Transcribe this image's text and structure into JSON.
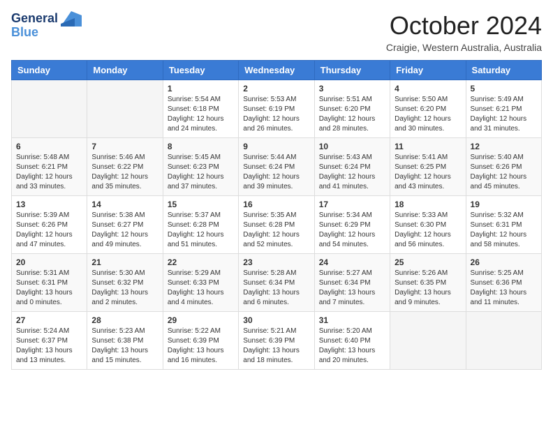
{
  "header": {
    "logo_line1": "General",
    "logo_line2": "Blue",
    "month_title": "October 2024",
    "location": "Craigie, Western Australia, Australia"
  },
  "weekdays": [
    "Sunday",
    "Monday",
    "Tuesday",
    "Wednesday",
    "Thursday",
    "Friday",
    "Saturday"
  ],
  "weeks": [
    [
      {
        "day": "",
        "info": ""
      },
      {
        "day": "",
        "info": ""
      },
      {
        "day": "1",
        "info": "Sunrise: 5:54 AM\nSunset: 6:18 PM\nDaylight: 12 hours and 24 minutes."
      },
      {
        "day": "2",
        "info": "Sunrise: 5:53 AM\nSunset: 6:19 PM\nDaylight: 12 hours and 26 minutes."
      },
      {
        "day": "3",
        "info": "Sunrise: 5:51 AM\nSunset: 6:20 PM\nDaylight: 12 hours and 28 minutes."
      },
      {
        "day": "4",
        "info": "Sunrise: 5:50 AM\nSunset: 6:20 PM\nDaylight: 12 hours and 30 minutes."
      },
      {
        "day": "5",
        "info": "Sunrise: 5:49 AM\nSunset: 6:21 PM\nDaylight: 12 hours and 31 minutes."
      }
    ],
    [
      {
        "day": "6",
        "info": "Sunrise: 5:48 AM\nSunset: 6:21 PM\nDaylight: 12 hours and 33 minutes."
      },
      {
        "day": "7",
        "info": "Sunrise: 5:46 AM\nSunset: 6:22 PM\nDaylight: 12 hours and 35 minutes."
      },
      {
        "day": "8",
        "info": "Sunrise: 5:45 AM\nSunset: 6:23 PM\nDaylight: 12 hours and 37 minutes."
      },
      {
        "day": "9",
        "info": "Sunrise: 5:44 AM\nSunset: 6:24 PM\nDaylight: 12 hours and 39 minutes."
      },
      {
        "day": "10",
        "info": "Sunrise: 5:43 AM\nSunset: 6:24 PM\nDaylight: 12 hours and 41 minutes."
      },
      {
        "day": "11",
        "info": "Sunrise: 5:41 AM\nSunset: 6:25 PM\nDaylight: 12 hours and 43 minutes."
      },
      {
        "day": "12",
        "info": "Sunrise: 5:40 AM\nSunset: 6:26 PM\nDaylight: 12 hours and 45 minutes."
      }
    ],
    [
      {
        "day": "13",
        "info": "Sunrise: 5:39 AM\nSunset: 6:26 PM\nDaylight: 12 hours and 47 minutes."
      },
      {
        "day": "14",
        "info": "Sunrise: 5:38 AM\nSunset: 6:27 PM\nDaylight: 12 hours and 49 minutes."
      },
      {
        "day": "15",
        "info": "Sunrise: 5:37 AM\nSunset: 6:28 PM\nDaylight: 12 hours and 51 minutes."
      },
      {
        "day": "16",
        "info": "Sunrise: 5:35 AM\nSunset: 6:28 PM\nDaylight: 12 hours and 52 minutes."
      },
      {
        "day": "17",
        "info": "Sunrise: 5:34 AM\nSunset: 6:29 PM\nDaylight: 12 hours and 54 minutes."
      },
      {
        "day": "18",
        "info": "Sunrise: 5:33 AM\nSunset: 6:30 PM\nDaylight: 12 hours and 56 minutes."
      },
      {
        "day": "19",
        "info": "Sunrise: 5:32 AM\nSunset: 6:31 PM\nDaylight: 12 hours and 58 minutes."
      }
    ],
    [
      {
        "day": "20",
        "info": "Sunrise: 5:31 AM\nSunset: 6:31 PM\nDaylight: 13 hours and 0 minutes."
      },
      {
        "day": "21",
        "info": "Sunrise: 5:30 AM\nSunset: 6:32 PM\nDaylight: 13 hours and 2 minutes."
      },
      {
        "day": "22",
        "info": "Sunrise: 5:29 AM\nSunset: 6:33 PM\nDaylight: 13 hours and 4 minutes."
      },
      {
        "day": "23",
        "info": "Sunrise: 5:28 AM\nSunset: 6:34 PM\nDaylight: 13 hours and 6 minutes."
      },
      {
        "day": "24",
        "info": "Sunrise: 5:27 AM\nSunset: 6:34 PM\nDaylight: 13 hours and 7 minutes."
      },
      {
        "day": "25",
        "info": "Sunrise: 5:26 AM\nSunset: 6:35 PM\nDaylight: 13 hours and 9 minutes."
      },
      {
        "day": "26",
        "info": "Sunrise: 5:25 AM\nSunset: 6:36 PM\nDaylight: 13 hours and 11 minutes."
      }
    ],
    [
      {
        "day": "27",
        "info": "Sunrise: 5:24 AM\nSunset: 6:37 PM\nDaylight: 13 hours and 13 minutes."
      },
      {
        "day": "28",
        "info": "Sunrise: 5:23 AM\nSunset: 6:38 PM\nDaylight: 13 hours and 15 minutes."
      },
      {
        "day": "29",
        "info": "Sunrise: 5:22 AM\nSunset: 6:39 PM\nDaylight: 13 hours and 16 minutes."
      },
      {
        "day": "30",
        "info": "Sunrise: 5:21 AM\nSunset: 6:39 PM\nDaylight: 13 hours and 18 minutes."
      },
      {
        "day": "31",
        "info": "Sunrise: 5:20 AM\nSunset: 6:40 PM\nDaylight: 13 hours and 20 minutes."
      },
      {
        "day": "",
        "info": ""
      },
      {
        "day": "",
        "info": ""
      }
    ]
  ]
}
